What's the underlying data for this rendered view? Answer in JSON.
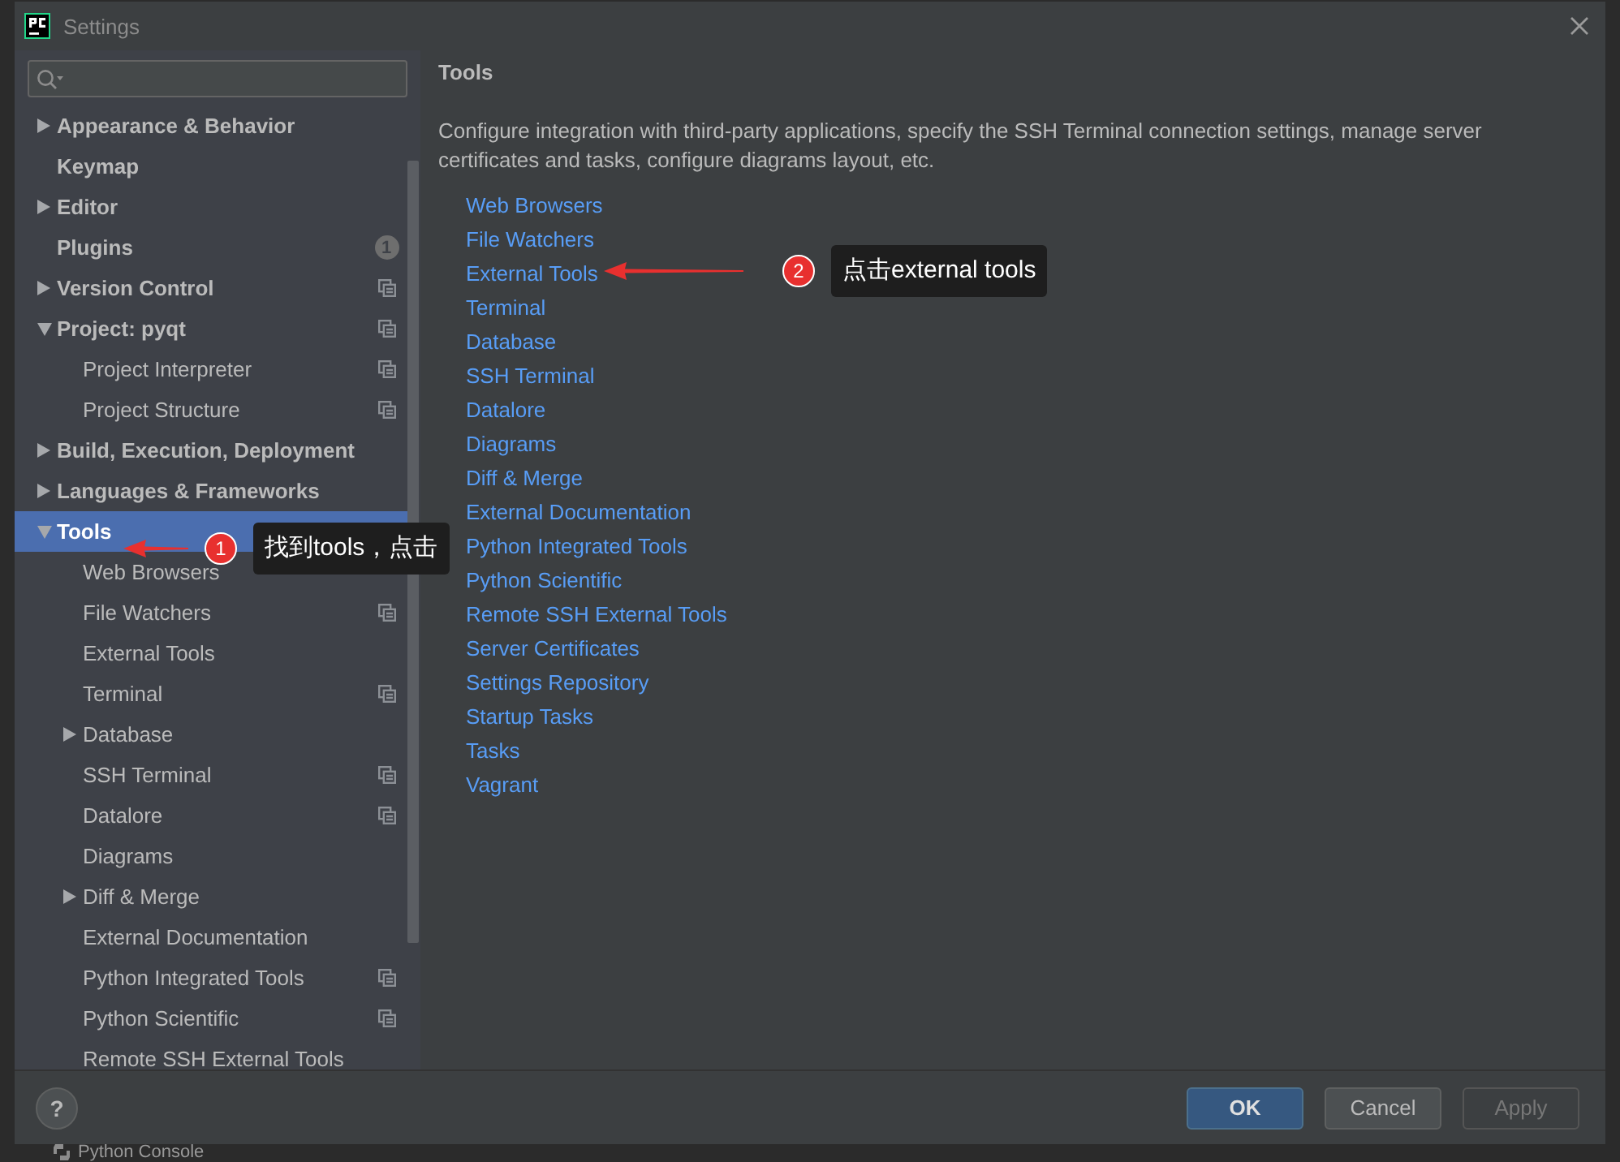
{
  "window": {
    "title": "Settings"
  },
  "help": {
    "label": "?"
  },
  "sidebar": {
    "items": [
      {
        "label": "Appearance & Behavior",
        "expanded": false,
        "has_children": true,
        "scoped": false,
        "selected": false
      },
      {
        "label": "Keymap",
        "has_children": false,
        "scoped": false,
        "selected": false
      },
      {
        "label": "Editor",
        "expanded": false,
        "has_children": true,
        "scoped": false,
        "selected": false
      },
      {
        "label": "Plugins",
        "has_children": false,
        "scoped": false,
        "badge": "1",
        "selected": false
      },
      {
        "label": "Version Control",
        "expanded": false,
        "has_children": true,
        "scoped": true,
        "selected": false
      },
      {
        "label": "Project: pyqt",
        "expanded": true,
        "has_children": true,
        "scoped": true,
        "selected": false,
        "children": [
          {
            "label": "Project Interpreter",
            "has_children": false,
            "scoped": true,
            "selected": false
          },
          {
            "label": "Project Structure",
            "has_children": false,
            "scoped": true,
            "selected": false
          }
        ]
      },
      {
        "label": "Build, Execution, Deployment",
        "expanded": false,
        "has_children": true,
        "scoped": false,
        "selected": false
      },
      {
        "label": "Languages & Frameworks",
        "expanded": false,
        "has_children": true,
        "scoped": false,
        "selected": false
      },
      {
        "label": "Tools",
        "expanded": true,
        "has_children": true,
        "scoped": false,
        "selected": true,
        "children": [
          {
            "label": "Web Browsers",
            "has_children": false,
            "scoped": false,
            "selected": false
          },
          {
            "label": "File Watchers",
            "has_children": false,
            "scoped": true,
            "selected": false
          },
          {
            "label": "External Tools",
            "has_children": false,
            "scoped": false,
            "selected": false
          },
          {
            "label": "Terminal",
            "has_children": false,
            "scoped": true,
            "selected": false
          },
          {
            "label": "Database",
            "expanded": false,
            "has_children": true,
            "scoped": false,
            "selected": false
          },
          {
            "label": "SSH Terminal",
            "has_children": false,
            "scoped": true,
            "selected": false
          },
          {
            "label": "Datalore",
            "has_children": false,
            "scoped": true,
            "selected": false
          },
          {
            "label": "Diagrams",
            "has_children": false,
            "scoped": false,
            "selected": false
          },
          {
            "label": "Diff & Merge",
            "expanded": false,
            "has_children": true,
            "scoped": false,
            "selected": false
          },
          {
            "label": "External Documentation",
            "has_children": false,
            "scoped": false,
            "selected": false
          },
          {
            "label": "Python Integrated Tools",
            "has_children": false,
            "scoped": true,
            "selected": false
          },
          {
            "label": "Python Scientific",
            "has_children": false,
            "scoped": true,
            "selected": false
          },
          {
            "label": "Remote SSH External Tools",
            "has_children": false,
            "scoped": false,
            "selected": false
          }
        ]
      }
    ]
  },
  "content": {
    "title": "Tools",
    "description": "Configure integration with third-party applications, specify the SSH Terminal connection settings, manage server certificates and tasks, configure diagrams layout, etc.",
    "links": [
      "Web Browsers",
      "File Watchers",
      "External Tools",
      "Terminal",
      "Database",
      "SSH Terminal",
      "Datalore",
      "Diagrams",
      "Diff & Merge",
      "External Documentation",
      "Python Integrated Tools",
      "Python Scientific",
      "Remote SSH External Tools",
      "Server Certificates",
      "Settings Repository",
      "Startup Tasks",
      "Tasks",
      "Vagrant"
    ]
  },
  "annotations": [
    {
      "number": "1",
      "text": "找到tools，点击"
    },
    {
      "number": "2",
      "text": "点击external tools"
    }
  ],
  "buttons": [
    {
      "label": "OK",
      "kind": "primary",
      "disabled": false
    },
    {
      "label": "Cancel",
      "kind": "normal",
      "disabled": false
    },
    {
      "label": "Apply",
      "kind": "normal",
      "disabled": true
    }
  ],
  "background": {
    "status_item": "Python Console"
  }
}
